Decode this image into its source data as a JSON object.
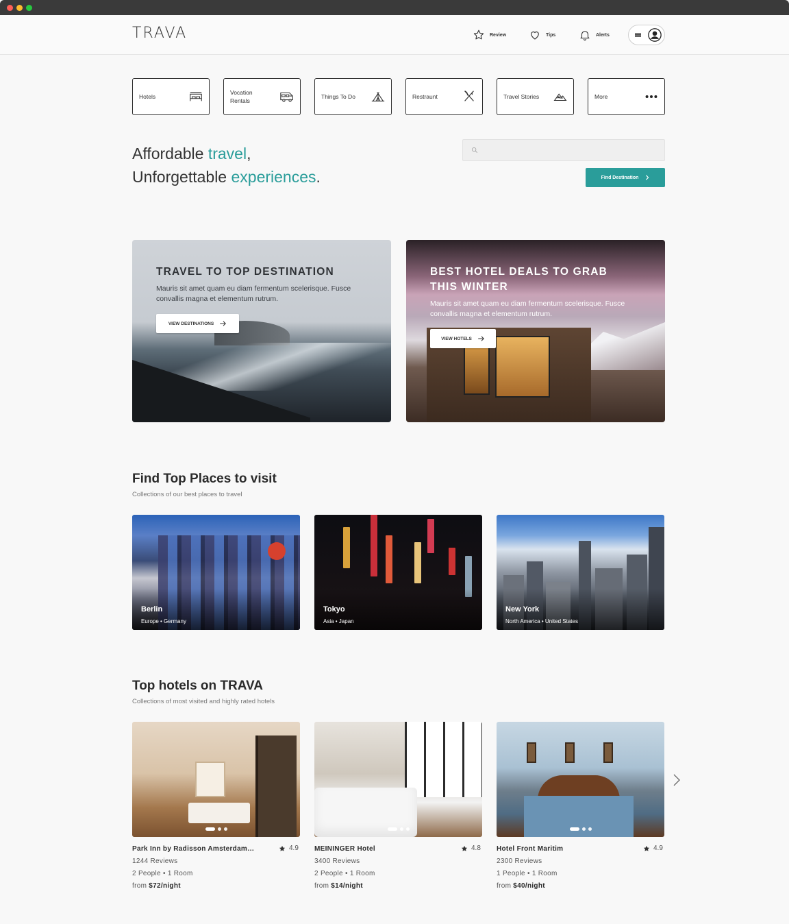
{
  "brand": {
    "logo": "TRAVA",
    "accent": "#2a9d9a"
  },
  "header": {
    "nav": [
      {
        "label": "Review",
        "icon": "star-icon"
      },
      {
        "label": "Tips",
        "icon": "heart-icon"
      },
      {
        "label": "Alerts",
        "icon": "bell-icon"
      }
    ],
    "menu_icon": "hamburger-icon",
    "avatar_icon": "user-icon"
  },
  "categories": [
    {
      "label": "Hotels",
      "icon": "hotel-bed-icon"
    },
    {
      "label": "Vocation Rentals",
      "icon": "camper-van-icon"
    },
    {
      "label": "Things To Do",
      "icon": "tent-icon"
    },
    {
      "label": "Restraunt",
      "icon": "cutlery-icon"
    },
    {
      "label": "Travel Stories",
      "icon": "mountain-icon"
    },
    {
      "label": "More",
      "icon": "more-dots-icon"
    }
  ],
  "hero": {
    "line1_prefix": "Affordable ",
    "line1_accent": "travel",
    "line1_suffix": ",",
    "line2_prefix": "Unforgettable ",
    "line2_accent": "experiences",
    "line2_suffix": ".",
    "search_placeholder": "",
    "find_button": "Find Destination"
  },
  "promos": [
    {
      "title": "TRAVEL TO TOP DESTINATION",
      "text": "Mauris sit amet quam eu diam fermentum scelerisque. Fusce convallis magna et elementum rutrum.",
      "button": "VIEW DESTINATIONS"
    },
    {
      "title": "BEST HOTEL DEALS TO GRAB THIS WINTER",
      "text": "Mauris sit amet quam eu diam fermentum scelerisque. Fusce convallis magna et elementum rutrum.",
      "button": "VIEW HOTELS"
    }
  ],
  "places_section": {
    "title": "Find Top Places to visit",
    "subtitle": "Collections of our best places to travel",
    "items": [
      {
        "name": "Berlin",
        "region": "Europe • Germany"
      },
      {
        "name": "Tokyo",
        "region": "Asia • Japan"
      },
      {
        "name": "New York",
        "region": "North America • United States"
      }
    ]
  },
  "hotels_section": {
    "title": "Top hotels on TRAVA",
    "subtitle": "Collections of most visited and highly rated hotels",
    "items": [
      {
        "name": "Park Inn by Radisson Amsterdam…",
        "rating": "4.9",
        "reviews": "1244 Reviews",
        "capacity": "2 People • 1 Room",
        "price_prefix": "from ",
        "price": "$72/night"
      },
      {
        "name": "MEININGER Hotel",
        "rating": "4.8",
        "reviews": "3400 Reviews",
        "capacity": "2 People • 1 Room",
        "price_prefix": "from ",
        "price": "$14/night"
      },
      {
        "name": "Hotel Front Maritim",
        "rating": "4.9",
        "reviews": "2300 Reviews",
        "capacity": "1 People • 1 Room",
        "price_prefix": "from ",
        "price": "$40/night"
      }
    ],
    "carousel_images_per_hotel": 3,
    "next_icon": "chevron-right-icon"
  }
}
